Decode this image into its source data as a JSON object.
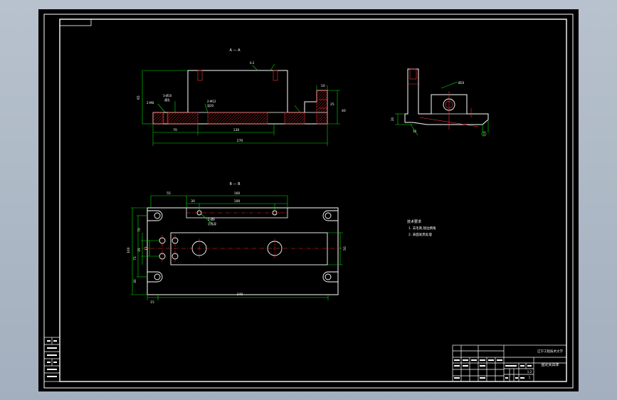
{
  "views": {
    "section_aa": {
      "label": "A — A"
    },
    "section_bb": {
      "label": "B — B"
    }
  },
  "top_view_dims": {
    "height_left": "65",
    "right_small_a": "10",
    "right_small_b": "40",
    "right_small_c": "25",
    "mid_a": "70",
    "mid_b": "130",
    "overall": "270",
    "thread_left": "2-M8",
    "hole_left": "3-Ø10",
    "hole_left_note": "通孔",
    "hole_mid": "2-M12",
    "hole_mid_note": "深20",
    "chamfer": "0.2"
  },
  "side_view_dims": {
    "top_label": "Ø20",
    "left_a": "20",
    "left_b": "10",
    "circle_marker": "1"
  },
  "bottom_view_dims": {
    "top_a": "55",
    "top_b": "160",
    "inner_a": "30",
    "inner_b": "100",
    "hole_note_a": "2-Ø9",
    "hole_note_b": "沉孔深",
    "left_total": "100",
    "left_a": "75",
    "left_b": "35",
    "left_c": "12",
    "left_d": "70",
    "left_e": "30",
    "right_a": "50",
    "bottom_a": "15",
    "bottom_total": "240"
  },
  "tech_notes": {
    "title": "技术要求",
    "line1": "1. 去毛刺,锐边倒角",
    "line2": "2. 表面发黑处理"
  },
  "title_block": {
    "school": "辽宁工程技术大学",
    "part_name": "固定夹具体",
    "scale": "1:2",
    "sheet": "1"
  }
}
